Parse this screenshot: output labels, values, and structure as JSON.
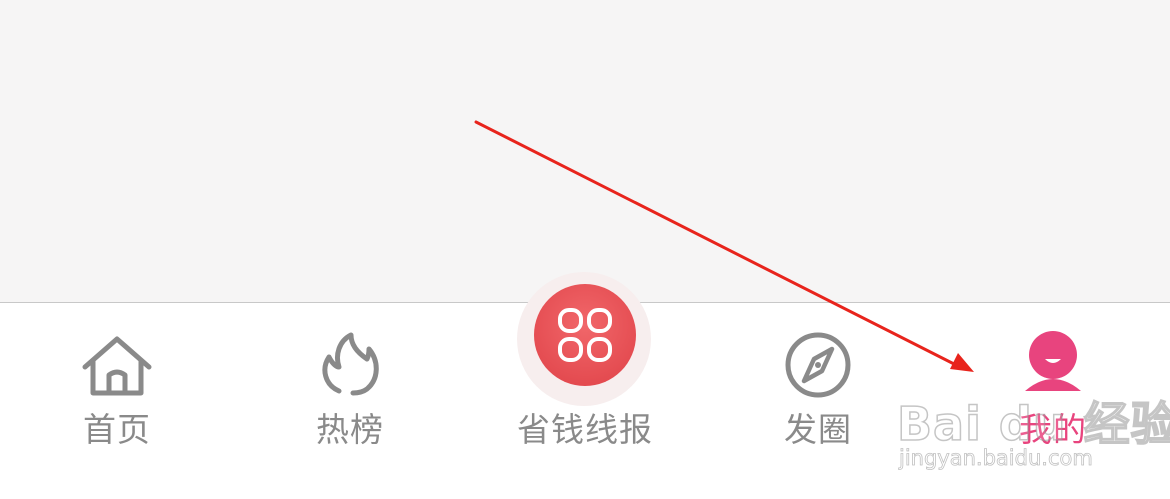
{
  "tabbar": {
    "tabs": [
      {
        "label": "首页",
        "icon": "home-icon",
        "active": false
      },
      {
        "label": "热榜",
        "icon": "flame-icon",
        "active": false
      },
      {
        "label": "省钱线报",
        "icon": "four-petals-icon",
        "active": false
      },
      {
        "label": "发圈",
        "icon": "compass-icon",
        "active": false
      },
      {
        "label": "我的",
        "icon": "user-avatar-icon",
        "active": true
      }
    ]
  },
  "colors": {
    "content_background": "#f6f5f5",
    "inactive": "#8a8a8a",
    "active": "#e8447e",
    "center_button": "#e44e52",
    "annotation_arrow": "#e8241c"
  },
  "watermark": {
    "logo": "Bai du 经验",
    "url": "jingyan.baidu.com"
  }
}
